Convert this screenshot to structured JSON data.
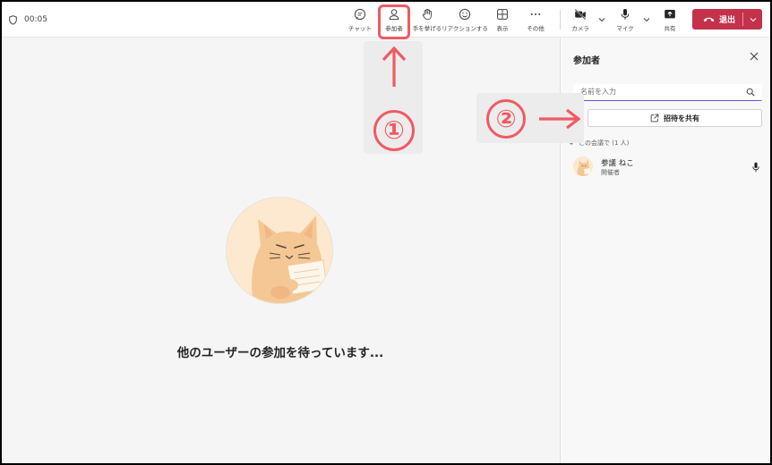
{
  "meeting": {
    "timer": "00:05"
  },
  "toolbar": {
    "chat": "チャット",
    "people": "参加者",
    "raise_hand": "手を挙げる",
    "reactions": "リアクションする",
    "view": "表示",
    "more": "その他",
    "camera": "カメラ",
    "mic": "マイク",
    "share": "共有",
    "leave": "退出"
  },
  "stage": {
    "waiting_message": "他のユーザーの参加を待っています..."
  },
  "panel": {
    "title": "参加者",
    "search_placeholder": "名前を入力",
    "invite_label": "招待を共有",
    "section_label": "この会議で (1 人)",
    "participants": [
      {
        "name": "参議 ねこ",
        "role": "開催者"
      }
    ]
  },
  "annotations": {
    "step1": "①",
    "step2": "②"
  },
  "colors": {
    "accent": "#5b5fc7",
    "leave": "#c4314b",
    "annotation": "#f05a63"
  }
}
